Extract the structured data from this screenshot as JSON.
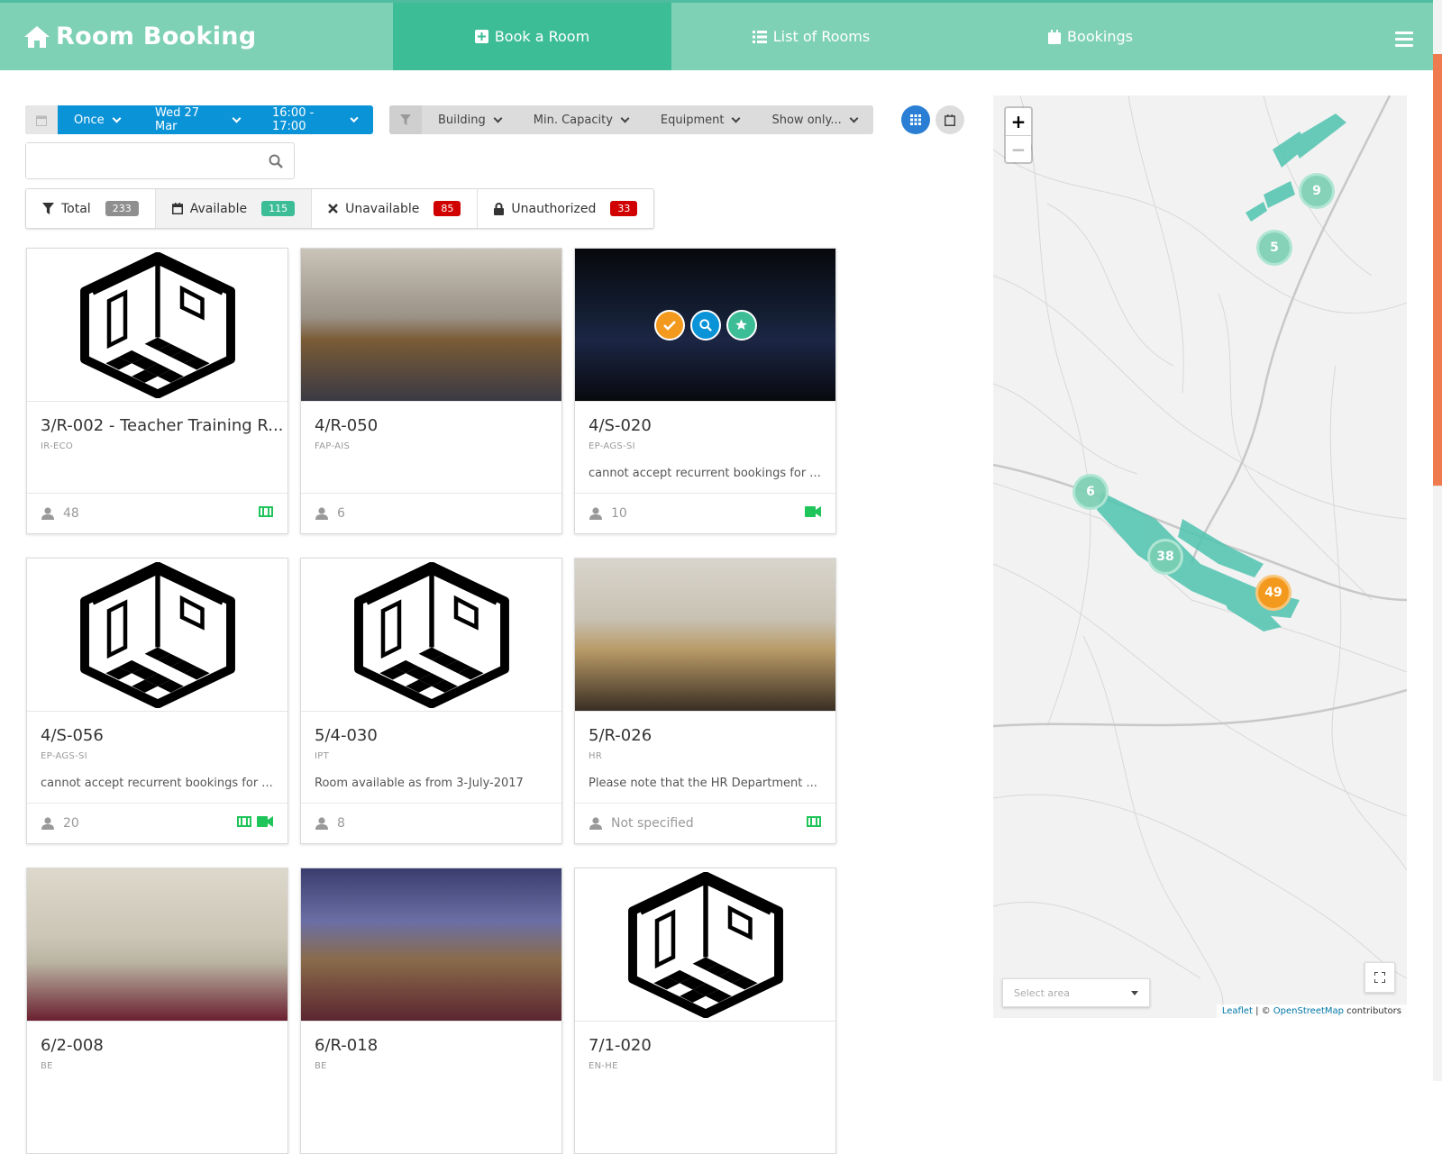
{
  "header": {
    "title": "Room Booking",
    "tabs": [
      {
        "label": "Book a Room",
        "icon": "plus-square-icon",
        "active": true
      },
      {
        "label": "List of Rooms",
        "icon": "list-icon",
        "active": false
      },
      {
        "label": "Bookings",
        "icon": "calendar-icon",
        "active": false
      }
    ]
  },
  "filters": {
    "recurrence": "Once",
    "date": "Wed 27 Mar",
    "time": "16:00 - 17:00",
    "building": "Building",
    "capacity": "Min. Capacity",
    "equipment": "Equipment",
    "show_only": "Show only..."
  },
  "search": {
    "placeholder": ""
  },
  "stats": {
    "total_label": "Total",
    "total": "233",
    "available_label": "Available",
    "available": "115",
    "unavailable_label": "Unavailable",
    "unavailable": "85",
    "unauthorized_label": "Unauthorized",
    "unauthorized": "33"
  },
  "rooms": [
    {
      "name": "3/R-002 - Teacher Training R...",
      "group": "IR-ECO",
      "desc": "",
      "capacity": "48",
      "image": "placeholder",
      "equipment": [
        "projector-icon"
      ]
    },
    {
      "name": "4/R-050",
      "group": "FAP-AIS",
      "desc": "",
      "capacity": "6",
      "image": "photo",
      "equipment": []
    },
    {
      "name": "4/S-020",
      "group": "EP-AGS-SI",
      "desc": "cannot accept recurrent bookings for ...",
      "capacity": "10",
      "image": "photo-hover",
      "equipment": [
        "video-icon"
      ]
    },
    {
      "name": "4/S-056",
      "group": "EP-AGS-SI",
      "desc": "cannot accept recurrent bookings for ...",
      "capacity": "20",
      "image": "placeholder",
      "equipment": [
        "projector-icon",
        "video-icon"
      ]
    },
    {
      "name": "5/4-030",
      "group": "IPT",
      "desc": "Room available as from 3-July-2017",
      "capacity": "8",
      "image": "placeholder",
      "equipment": []
    },
    {
      "name": "5/R-026",
      "group": "HR",
      "desc": "Please note that the HR Department ...",
      "capacity": "Not specified",
      "image": "photo",
      "equipment": [
        "projector-icon"
      ]
    },
    {
      "name": "6/2-008",
      "group": "BE",
      "desc": "",
      "capacity": "",
      "image": "photo",
      "equipment": []
    },
    {
      "name": "6/R-018",
      "group": "BE",
      "desc": "",
      "capacity": "",
      "image": "photo",
      "equipment": []
    },
    {
      "name": "7/1-020",
      "group": "EN-HE",
      "desc": "",
      "capacity": "",
      "image": "placeholder",
      "equipment": []
    }
  ],
  "map": {
    "zoom_in": "+",
    "zoom_out": "−",
    "clusters": [
      {
        "count": "9",
        "color": "green"
      },
      {
        "count": "5",
        "color": "green"
      },
      {
        "count": "6",
        "color": "green"
      },
      {
        "count": "38",
        "color": "green"
      },
      {
        "count": "49",
        "color": "orange"
      }
    ],
    "select_area": "Select area",
    "attribution_leaflet": "Leaflet",
    "attribution_sep": " | © ",
    "attribution_osm": "OpenStreetMap",
    "attribution_tail": " contributors"
  },
  "colors": {
    "header": "#7fd1b5",
    "active_tab": "#3dbd96",
    "primary": "#0b93d8",
    "badge_total": "#8f8f8f",
    "badge_available": "#3dbd96",
    "badge_unavailable": "#d10000",
    "equipment": "#1fc55a",
    "cluster_orange": "#f39a1e"
  }
}
